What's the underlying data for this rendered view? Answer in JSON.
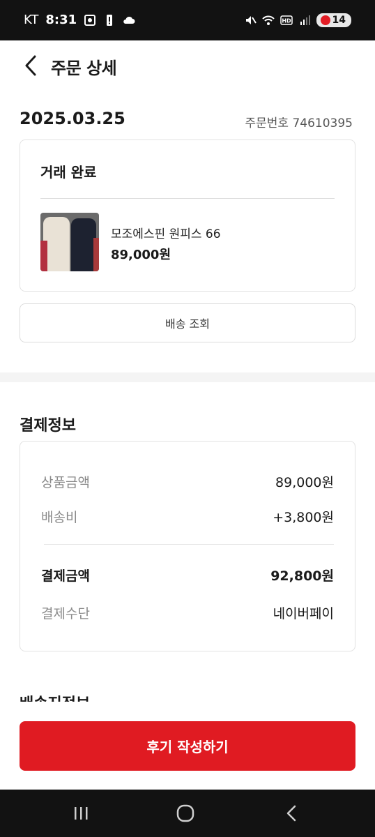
{
  "status_bar": {
    "carrier": "KT",
    "time": "8:31",
    "battery": "14"
  },
  "header": {
    "title": "주문 상세"
  },
  "order": {
    "date": "2025.03.25",
    "order_number": "주문번호 74610395",
    "status": "거래 완료",
    "product": {
      "name": "모조에스핀 원피스 66",
      "price": "89,000원"
    },
    "track_button": "배송 조회"
  },
  "payment": {
    "title": "결제정보",
    "rows": [
      {
        "label": "상품금액",
        "value": "89,000원"
      },
      {
        "label": "배송비",
        "value": "+3,800원"
      },
      {
        "label": "결제금액",
        "value": "92,800원"
      },
      {
        "label": "결제수단",
        "value": "네이버페이"
      }
    ]
  },
  "next_section_title": "배송지정보",
  "review_button": "후기 작성하기",
  "colors": {
    "accent": "#e01b22",
    "status_bar": "#121212"
  }
}
